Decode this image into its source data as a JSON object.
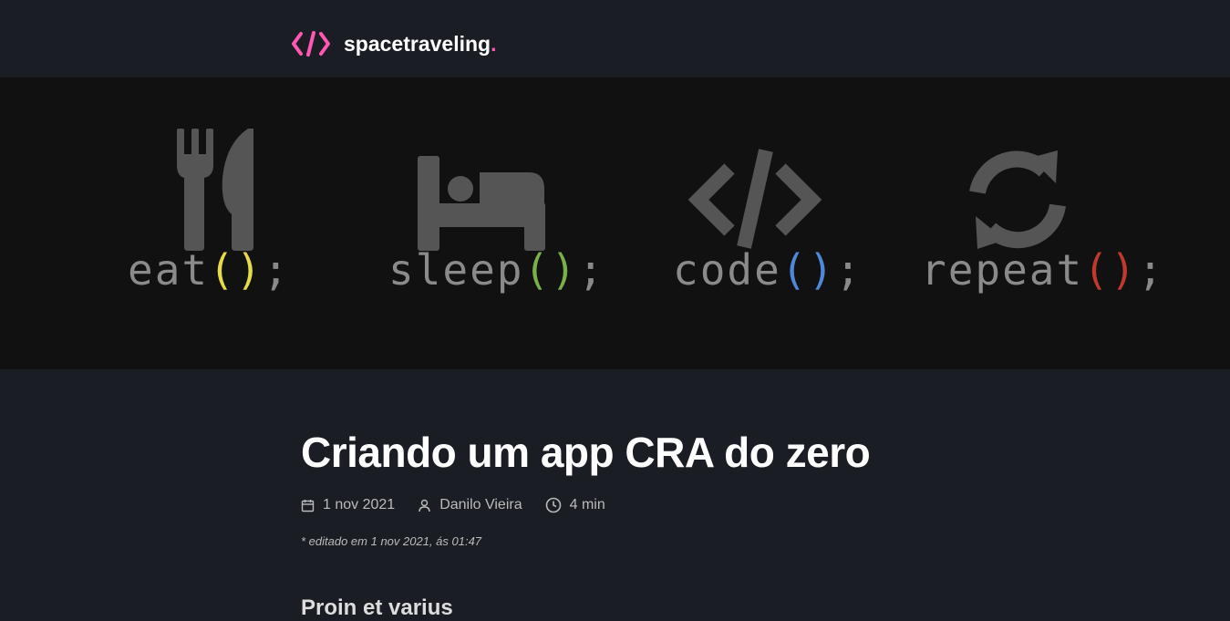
{
  "header": {
    "logo_text": "spacetraveling",
    "logo_dot": ".",
    "logo_icon": "code-brackets-icon",
    "accent_color": "#ff57b2"
  },
  "banner": {
    "words": [
      {
        "word": "eat",
        "paren": "()",
        "semicolon": ";",
        "paren_color": "#e6d94a",
        "icon": "fork-knife-icon"
      },
      {
        "word": "sleep",
        "paren": "()",
        "semicolon": ";",
        "paren_color": "#7ab04a",
        "icon": "bed-icon"
      },
      {
        "word": "code",
        "paren": "()",
        "semicolon": ";",
        "paren_color": "#4f87d9",
        "icon": "code-icon"
      },
      {
        "word": "repeat",
        "paren": "()",
        "semicolon": ";",
        "paren_color": "#c03a2b",
        "icon": "refresh-icon"
      }
    ]
  },
  "post": {
    "title": "Criando um app CRA do zero",
    "date": "1 nov 2021",
    "author": "Danilo Vieira",
    "reading_time": "4 min",
    "edited": "* editado em 1 nov 2021, ás 01:47",
    "first_heading": "Proin et varius"
  }
}
